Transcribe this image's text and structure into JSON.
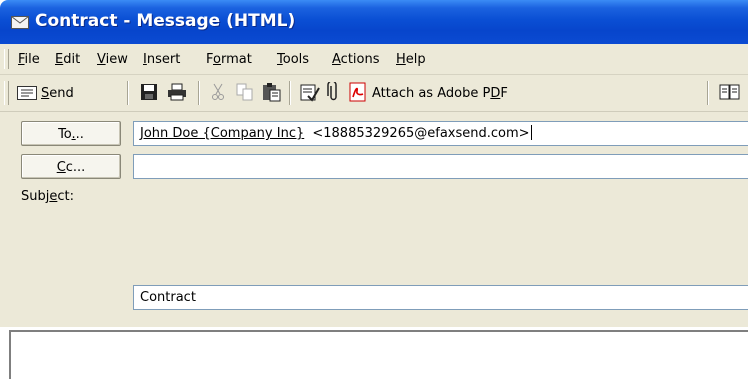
{
  "window": {
    "title": "Contract - Message (HTML)"
  },
  "menu": {
    "items": [
      {
        "pre": "",
        "acc": "F",
        "post": "ile"
      },
      {
        "pre": "",
        "acc": "E",
        "post": "dit"
      },
      {
        "pre": "",
        "acc": "V",
        "post": "iew"
      },
      {
        "pre": "",
        "acc": "I",
        "post": "nsert"
      },
      {
        "pre": "F",
        "acc": "o",
        "post": "rmat"
      },
      {
        "pre": "",
        "acc": "T",
        "post": "ools"
      },
      {
        "pre": "",
        "acc": "A",
        "post": "ctions"
      },
      {
        "pre": "",
        "acc": "H",
        "post": "elp"
      }
    ]
  },
  "toolbar": {
    "send": {
      "pre": "",
      "acc": "S",
      "post": "end"
    },
    "attach_pdf": {
      "pre": "Attach as Adobe P",
      "acc": "D",
      "post": "F"
    },
    "icons": [
      "send-icon",
      "save-icon",
      "print-icon",
      "cut-icon",
      "copy-icon",
      "paste-icon",
      "check-names-icon",
      "attach-file-icon",
      "adobe-pdf-icon",
      "address-book-icon"
    ]
  },
  "fields": {
    "to_button": {
      "pre": "To",
      "acc": ".",
      "post": ".."
    },
    "cc_button": {
      "pre": "",
      "acc": "C",
      "post": "c..."
    },
    "subject_label": {
      "pre": "Subj",
      "acc": "e",
      "post": "ct:"
    },
    "to_name": "John Doe {Company Inc}",
    "to_address": "<18885329265@efaxsend.com>",
    "cc_value": "",
    "subject_value": "Contract"
  }
}
